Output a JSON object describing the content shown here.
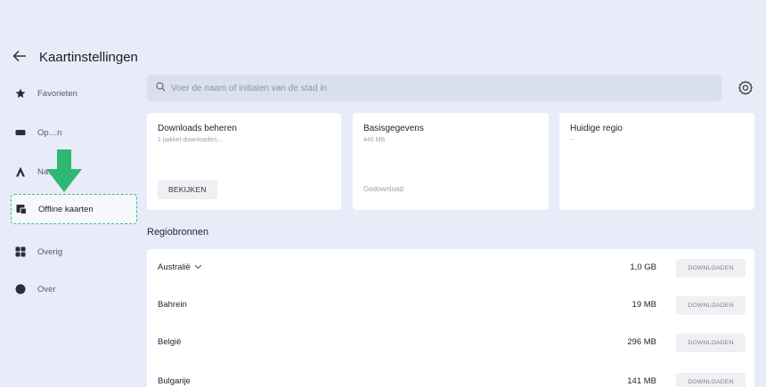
{
  "header": {
    "title": "Kaartinstellingen",
    "back_icon": "back-arrow-icon"
  },
  "sidebar": {
    "items": [
      {
        "label": "Favorieten",
        "icon": "star-icon"
      },
      {
        "label": "Op…n",
        "icon": "car-icon"
      },
      {
        "label": "Na…e",
        "icon": "navigation-icon"
      },
      {
        "label": "Offline kaarten",
        "icon": "offline-maps-icon",
        "active": true
      },
      {
        "label": "Overig",
        "icon": "grid-icon"
      },
      {
        "label": "Over",
        "icon": "info-icon"
      }
    ]
  },
  "search": {
    "placeholder": "Voer de naam of initialen van de stad in"
  },
  "cards": {
    "downloads": {
      "title": "Downloads beheren",
      "subtitle": "1 pakket downloaden...",
      "button": "BEKIJKEN"
    },
    "base": {
      "title": "Basisgegevens",
      "subtitle": "440 MB",
      "status": "Gedownload"
    },
    "current": {
      "title": "Huidige regio",
      "subtitle": "--"
    }
  },
  "section": {
    "heading": "Regiobronnen"
  },
  "regions": [
    {
      "name": "Australië",
      "size": "1,0 GB",
      "button": "DOWNLOADEN",
      "expandable": true
    },
    {
      "name": "Bahrein",
      "size": "19 MB",
      "button": "DOWNLOADEN"
    },
    {
      "name": "België",
      "size": "296 MB",
      "button": "DOWNLOADEN"
    },
    {
      "name": "Bulgarije",
      "size": "141 MB",
      "button": "DOWNLOADEN"
    }
  ],
  "colors": {
    "background": "#e8ecf8",
    "highlight_border": "#34c07a",
    "arrow": "#2fb872"
  }
}
